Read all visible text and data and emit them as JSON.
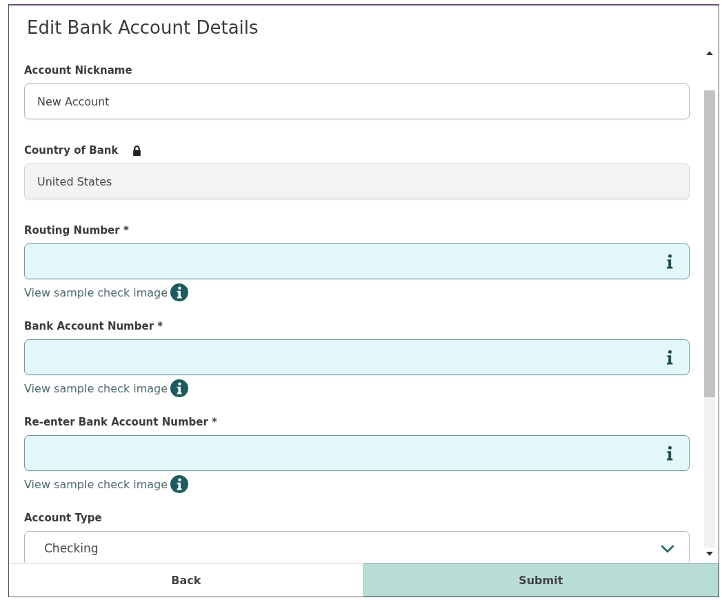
{
  "dialog": {
    "title": "Edit Bank Account Details"
  },
  "fields": [
    {
      "kind": "text",
      "label": "Account Nickname",
      "value": "New Account"
    },
    {
      "kind": "locked",
      "label": "Country of Bank",
      "value": "United States"
    },
    {
      "kind": "info",
      "label": "Routing Number *",
      "link": "View sample check image"
    },
    {
      "kind": "info",
      "label": "Bank Account Number *",
      "link": "View sample check image"
    },
    {
      "kind": "info",
      "label": "Re-enter Bank Account Number *",
      "link": "View sample check image"
    },
    {
      "kind": "select",
      "label": "Account Type",
      "value": "Checking"
    }
  ],
  "buttons": [
    {
      "label": "Back",
      "primary": false
    },
    {
      "label": "Submit",
      "primary": true
    }
  ]
}
